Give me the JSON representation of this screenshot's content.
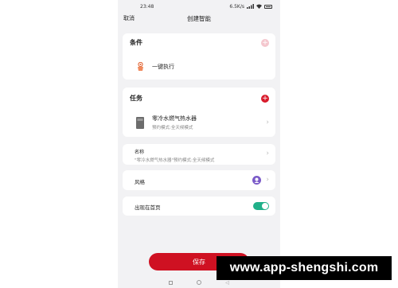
{
  "status_bar": {
    "time": "23:48",
    "right_text": "6.5K/s"
  },
  "navbar": {
    "cancel_label": "取消",
    "title": "创建智能"
  },
  "condition": {
    "section_title": "条件",
    "add_icon": "plus-icon",
    "item_icon": "hand-icon",
    "item_label": "一键执行"
  },
  "tasks": {
    "section_title": "任务",
    "add_icon": "plus-icon",
    "device": {
      "name": "零冷水燃气热水器",
      "detail": "预约模式:全天候模式",
      "icon": "water-heater-icon"
    }
  },
  "name_field": {
    "label": "名称",
    "value": "\"零冷水燃气热水器\"预约模式:全天候模式"
  },
  "style_field": {
    "label": "风格",
    "icon": "style-icon",
    "icon_color": "#7a5ac8"
  },
  "home_field": {
    "label": "出现在首页",
    "enabled": true,
    "toggle_color": "#20b089"
  },
  "save_label": "保存",
  "watermark_text": "www.app-shengshi.com",
  "colors": {
    "accent": "#d8192a",
    "background": "#f2f2f4"
  }
}
